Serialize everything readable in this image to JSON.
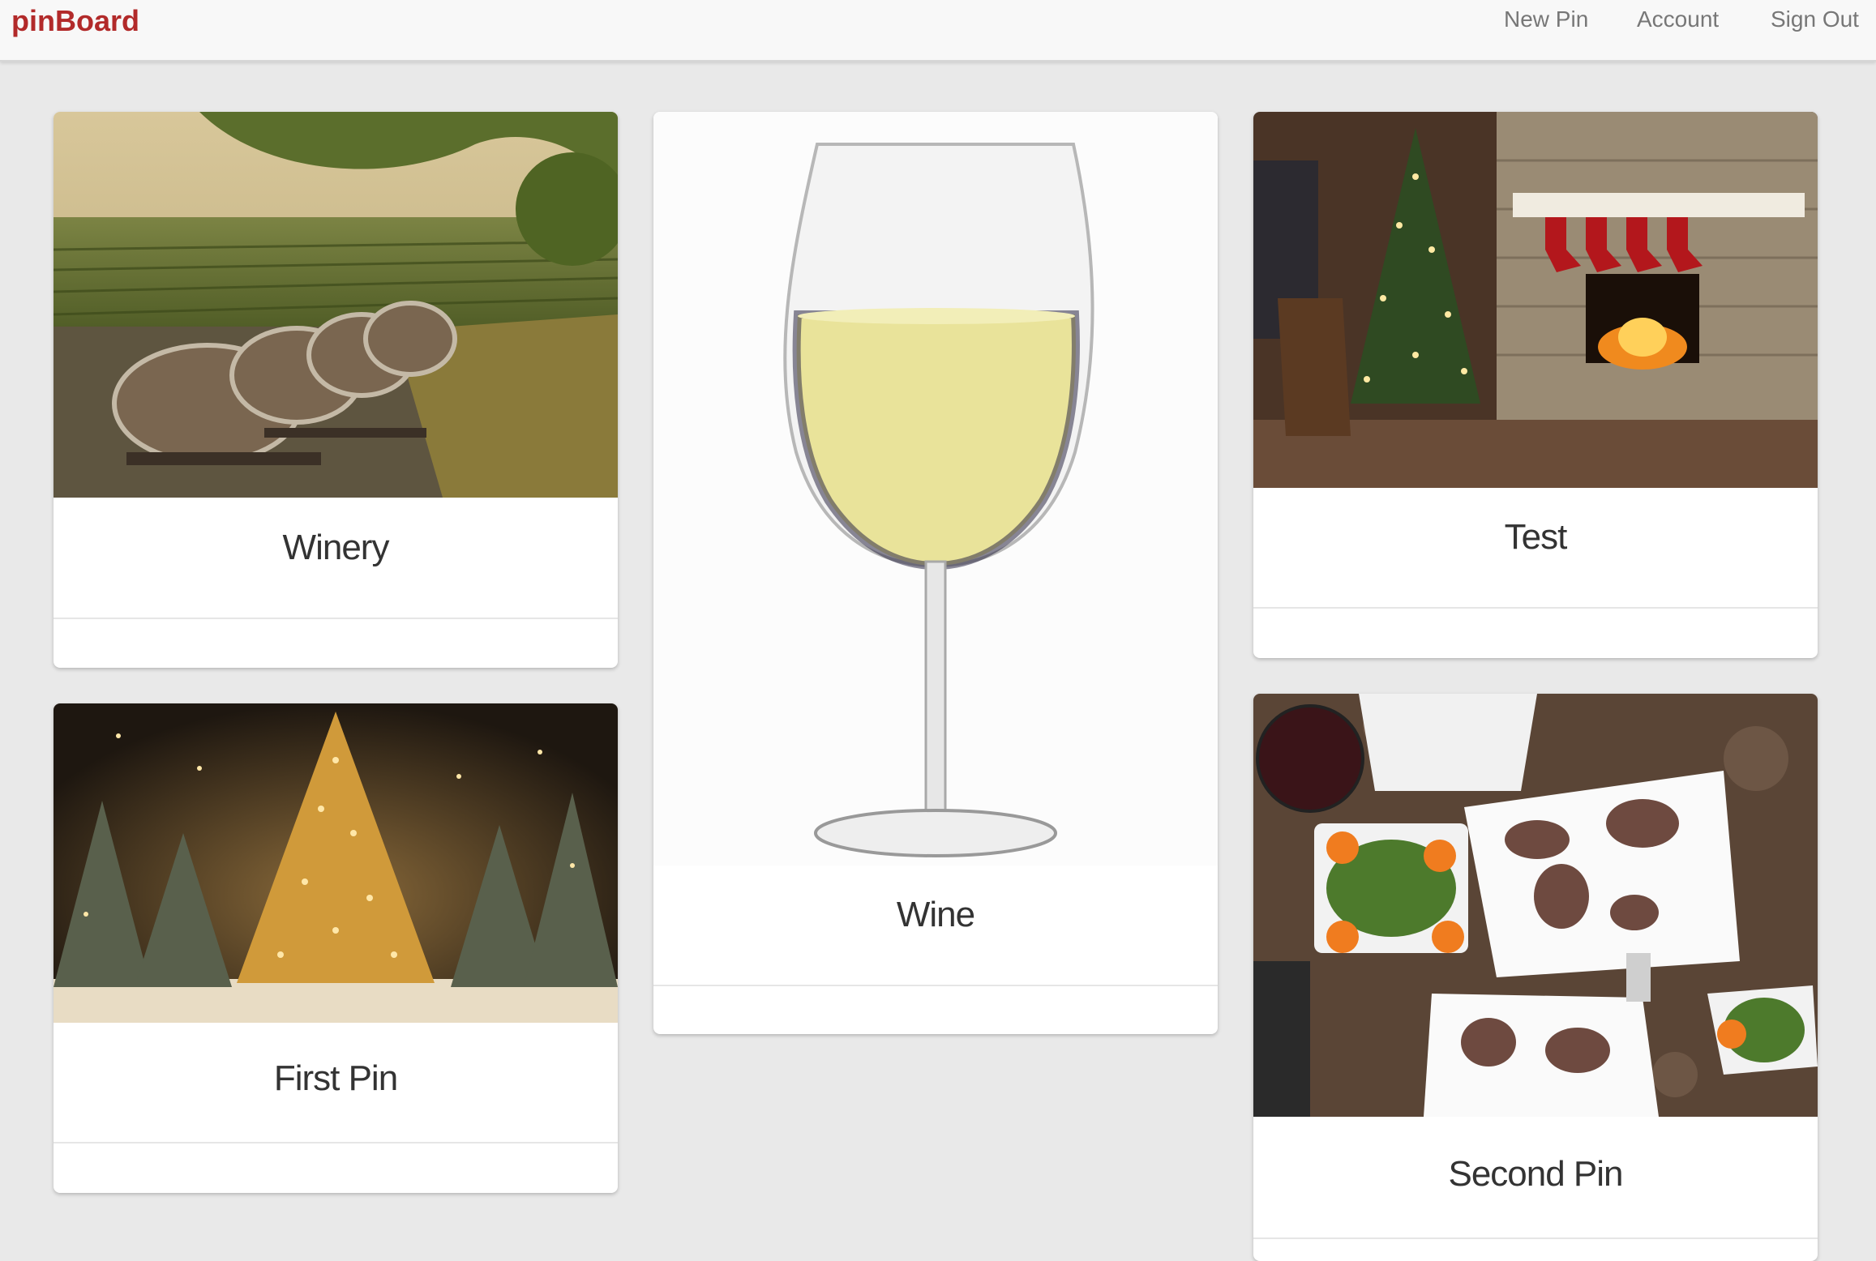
{
  "navbar": {
    "brand": "pinBoard",
    "links": [
      {
        "label": "New Pin"
      },
      {
        "label": "Account"
      },
      {
        "label": "Sign Out"
      }
    ]
  },
  "pins": [
    {
      "title": "Winery",
      "image": "vineyard-barrels-photo"
    },
    {
      "title": "Wine",
      "image": "white-wine-glass-photo"
    },
    {
      "title": "Test",
      "image": "christmas-fireplace-photo"
    },
    {
      "title": "First Pin",
      "image": "christmas-trees-photo"
    },
    {
      "title": "Second Pin",
      "image": "steak-salad-dinner-photo"
    }
  ],
  "colors": {
    "brand": "#b22a2a",
    "background": "#e9e9e9",
    "nav_text": "#777777"
  }
}
